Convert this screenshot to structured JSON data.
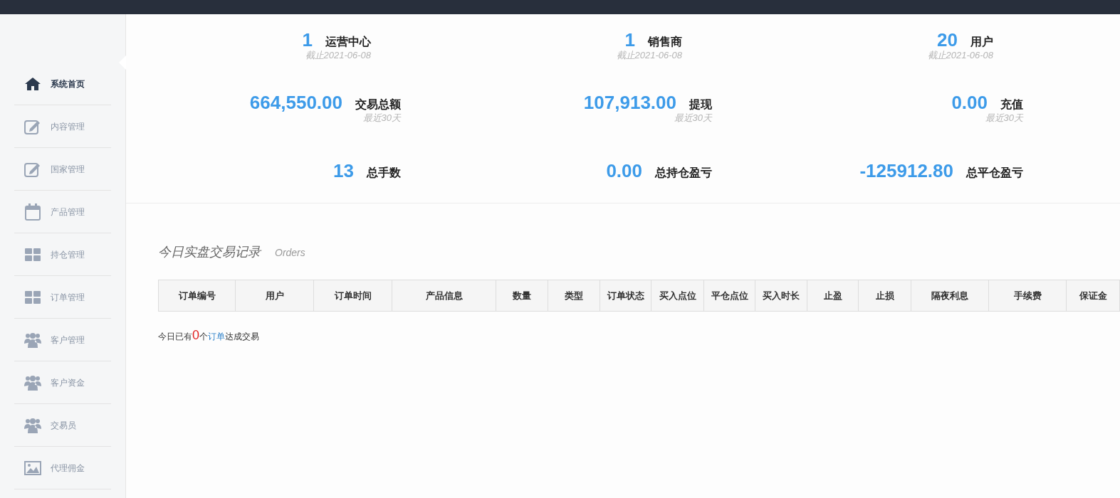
{
  "sidebar": {
    "items": [
      {
        "label": "系统首页",
        "selected": true
      },
      {
        "label": "内容管理",
        "selected": false
      },
      {
        "label": "国家管理",
        "selected": false
      },
      {
        "label": "产品管理",
        "selected": false
      },
      {
        "label": "持仓管理",
        "selected": false
      },
      {
        "label": "订单管理",
        "selected": false
      },
      {
        "label": "客户管理",
        "selected": false
      },
      {
        "label": "客户资金",
        "selected": false
      },
      {
        "label": "交易员",
        "selected": false
      },
      {
        "label": "代理佣金",
        "selected": false
      }
    ]
  },
  "stats": [
    [
      {
        "value": "1",
        "label": "运营中心",
        "note": "截止2021-06-08"
      },
      {
        "value": "1",
        "label": "销售商",
        "note": "截止2021-06-08"
      },
      {
        "value": "20",
        "label": "用户",
        "note": "截止2021-06-08"
      }
    ],
    [
      {
        "value": "664,550.00",
        "label": "交易总额",
        "note": "最近30天"
      },
      {
        "value": "107,913.00",
        "label": "提现",
        "note": "最近30天"
      },
      {
        "value": "0.00",
        "label": "充值",
        "note": "最近30天"
      }
    ],
    [
      {
        "value": "13",
        "label": "总手数"
      },
      {
        "value": "0.00",
        "label": "总持仓盈亏"
      },
      {
        "value": "-125912.80",
        "label": "总平仓盈亏"
      }
    ]
  ],
  "orders": {
    "title": "今日实盘交易记录",
    "subtitle": "Orders",
    "table": {
      "columns": [
        "订单编号",
        "用户",
        "订单时间",
        "产品信息",
        "数量",
        "类型",
        "订单状态",
        "买入点位",
        "平仓点位",
        "买入时长",
        "止盈",
        "止损",
        "隔夜利息",
        "手续费",
        "保证金"
      ]
    },
    "summary": {
      "prefix": "今日已有",
      "count": "0",
      "middle": "个",
      "link": "订单",
      "suffix": "达成交易"
    }
  }
}
